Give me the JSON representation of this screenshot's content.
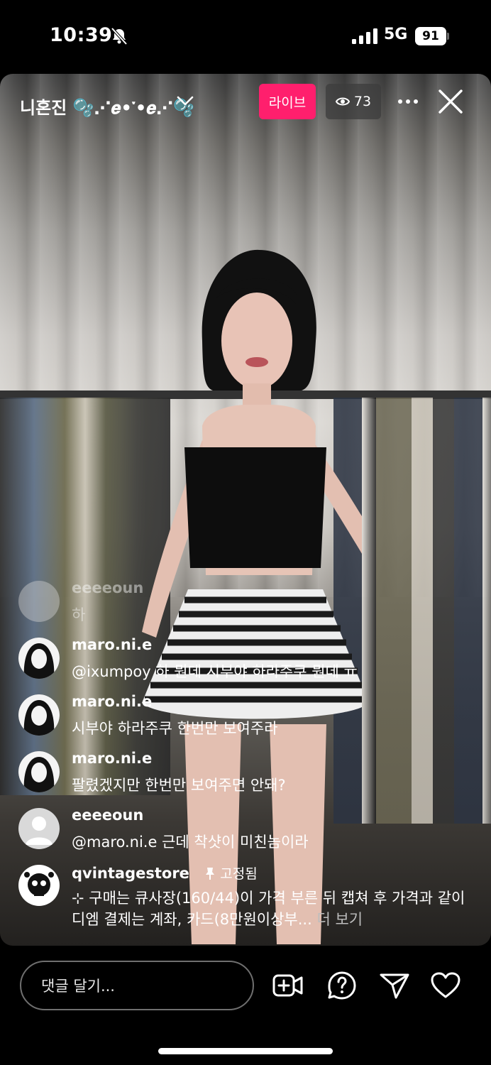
{
  "status_bar": {
    "time": "10:39",
    "network": "5G",
    "battery": "91",
    "icons": [
      "bell-slash-icon",
      "signal-icon",
      "battery-icon"
    ]
  },
  "live": {
    "host_name": "니혼진 🫧⋰𝒆•༌•𝒆⋰🫧",
    "live_label": "라이브",
    "viewer_count": "73",
    "accent_color": "#ff1f6d"
  },
  "comments": [
    {
      "user": "eeeeoun",
      "text": "하",
      "faded": true
    },
    {
      "user": "maro.ni.e",
      "text": "@ixumpoy 하 뭔데 시부야 하라주쿠 뭔데 ㅠ"
    },
    {
      "user": "maro.ni.e",
      "text": "시부야 하라주쿠 한번만 보여주라"
    },
    {
      "user": "maro.ni.e",
      "text": "팔렸겠지만 한번만 보여주면 안돼?"
    },
    {
      "user": "eeeeoun",
      "text": "@maro.ni.e 근데 착샷이 미친놈이라"
    },
    {
      "user": "qvintagestore",
      "pinned_label": "고정됨",
      "text": "⊹ 구매는 큐사장(160/44)이 가격 부른 뒤 캡쳐 후 가격과 같이 디엠 결제는 계좌, 카드(8만원이상부...",
      "more": "더 보기"
    }
  ],
  "bottom_bar": {
    "comment_placeholder": "댓글 달기...",
    "icons": [
      "add-video-icon",
      "question-icon",
      "send-icon",
      "heart-icon"
    ]
  }
}
